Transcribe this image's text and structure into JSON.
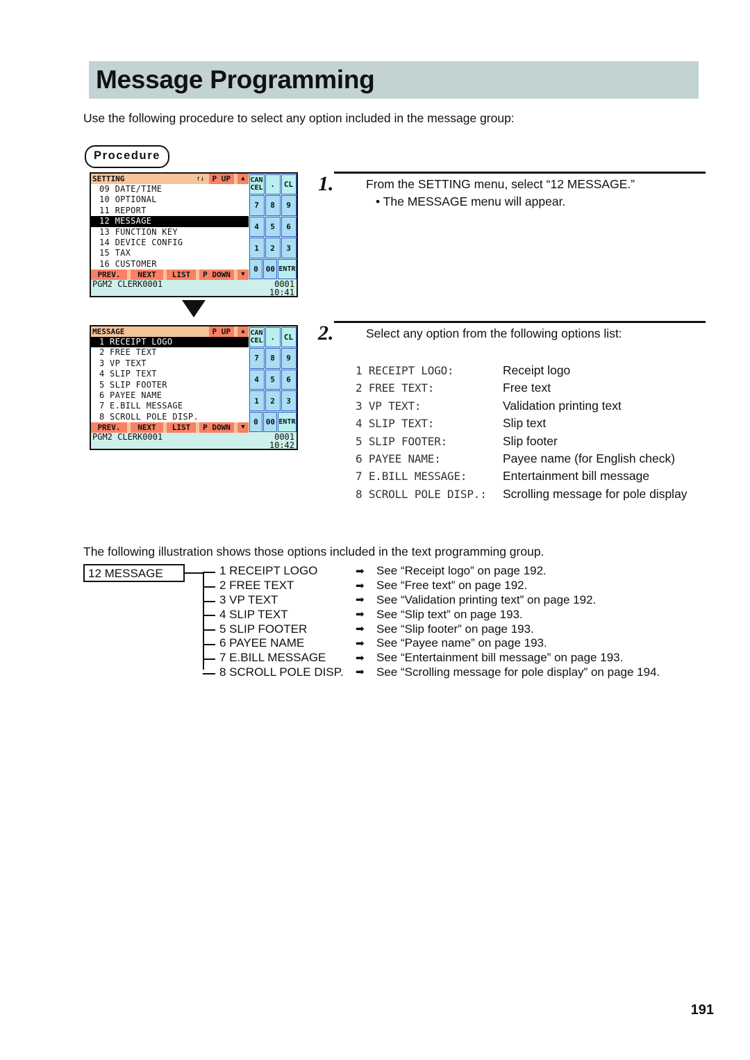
{
  "page": {
    "title": "Message Programming",
    "intro": "Use the following procedure to select any option included in the message group:",
    "procedure_badge": "Procedure",
    "illustration_note": "The following illustration shows those options included in the text programming group.",
    "page_number": "191"
  },
  "colors": {
    "banner": "#c3d2d2",
    "lcd_header": "#f6c49b",
    "lcd_softkey": "#fa8064",
    "lcd_status": "#cdf0ea",
    "keypad_key": "#a9ddf5",
    "keypad_key_pale": "#b8efef",
    "keypad_border": "#3a5fc8",
    "selected_row_bg": "#000000"
  },
  "lcd_setting": {
    "header_title": "SETTING",
    "header_updown_icon": "up-down-arrow-icon",
    "header_updown": "↑↓",
    "header_page_up": "P UP",
    "header_triangle": "▲",
    "rows": [
      {
        "label": "09 DATE/TIME",
        "selected": false
      },
      {
        "label": "10 OPTIONAL",
        "selected": false
      },
      {
        "label": "11 REPORT",
        "selected": false
      },
      {
        "label": "12 MESSAGE",
        "selected": true
      },
      {
        "label": "13 FUNCTION KEY",
        "selected": false
      },
      {
        "label": "14 DEVICE CONFIG",
        "selected": false
      },
      {
        "label": "15 TAX",
        "selected": false
      },
      {
        "label": "16 CUSTOMER",
        "selected": false
      }
    ],
    "softkeys": [
      "PREV.",
      "NEXT",
      "LIST",
      "P DOWN"
    ],
    "soft_triangle": "▼",
    "status_left": "PGM2    CLERK0001",
    "status_right": "0001",
    "status_time": "10:41",
    "keypad": [
      [
        "CANCEL",
        ".",
        "CL"
      ],
      [
        "7",
        "8",
        "9"
      ],
      [
        "4",
        "5",
        "6"
      ],
      [
        "1",
        "2",
        "3"
      ],
      [
        "0",
        "00",
        "ENTR"
      ]
    ]
  },
  "lcd_message": {
    "header_title": "MESSAGE",
    "header_page_up": "P UP",
    "header_triangle": "▲",
    "rows": [
      {
        "label": "1 RECEIPT LOGO",
        "selected": true
      },
      {
        "label": "2 FREE TEXT",
        "selected": false
      },
      {
        "label": "3 VP TEXT",
        "selected": false
      },
      {
        "label": "4 SLIP TEXT",
        "selected": false
      },
      {
        "label": "5 SLIP FOOTER",
        "selected": false
      },
      {
        "label": "6 PAYEE NAME",
        "selected": false
      },
      {
        "label": "7 E.BILL MESSAGE",
        "selected": false
      },
      {
        "label": "8 SCROLL POLE DISP.",
        "selected": false
      }
    ],
    "softkeys": [
      "PREV.",
      "NEXT",
      "LIST",
      "P DOWN"
    ],
    "soft_triangle": "▼",
    "status_left": "PGM2    CLERK0001",
    "status_right": "0001",
    "status_time": "10:42",
    "keypad": [
      [
        "CANCEL",
        ".",
        "CL"
      ],
      [
        "7",
        "8",
        "9"
      ],
      [
        "4",
        "5",
        "6"
      ],
      [
        "1",
        "2",
        "3"
      ],
      [
        "0",
        "00",
        "ENTR"
      ]
    ]
  },
  "steps": [
    {
      "number": "1.",
      "line1": "From the SETTING menu, select “12 MESSAGE.”",
      "line2": "• The MESSAGE menu will appear."
    },
    {
      "number": "2.",
      "line1": "Select any option from the following options list:"
    }
  ],
  "options": [
    {
      "code": "1 RECEIPT LOGO:",
      "desc": "Receipt logo"
    },
    {
      "code": "2 FREE TEXT:",
      "desc": "Free text"
    },
    {
      "code": "3 VP TEXT:",
      "desc": "Validation printing text"
    },
    {
      "code": "4 SLIP TEXT:",
      "desc": "Slip text"
    },
    {
      "code": "5 SLIP FOOTER:",
      "desc": "Slip footer"
    },
    {
      "code": "6 PAYEE NAME:",
      "desc": "Payee name (for English check)"
    },
    {
      "code": "7 E.BILL MESSAGE:",
      "desc": "Entertainment bill message"
    },
    {
      "code": "8 SCROLL POLE DISP.:",
      "desc": "Scrolling message for pole display"
    }
  ],
  "tree": {
    "root_label": "12 MESSAGE",
    "arrow_icon": "right-arrow-icon",
    "arrow_glyph": "➡",
    "items": [
      {
        "label": "1 RECEIPT LOGO",
        "ref": "See “Receipt logo” on page 192."
      },
      {
        "label": "2 FREE TEXT",
        "ref": "See “Free text” on page 192."
      },
      {
        "label": "3 VP TEXT",
        "ref": "See “Validation printing text” on page 192."
      },
      {
        "label": "4 SLIP TEXT",
        "ref": "See “Slip text” on page 193."
      },
      {
        "label": "5 SLIP FOOTER",
        "ref": "See “Slip footer” on page 193."
      },
      {
        "label": "6 PAYEE NAME",
        "ref": "See “Payee name” on page 193."
      },
      {
        "label": "7 E.BILL MESSAGE",
        "ref": "See “Entertainment bill message” on page 193."
      },
      {
        "label": "8 SCROLL POLE DISP.",
        "ref": "See “Scrolling message for pole display” on page 194."
      }
    ]
  }
}
